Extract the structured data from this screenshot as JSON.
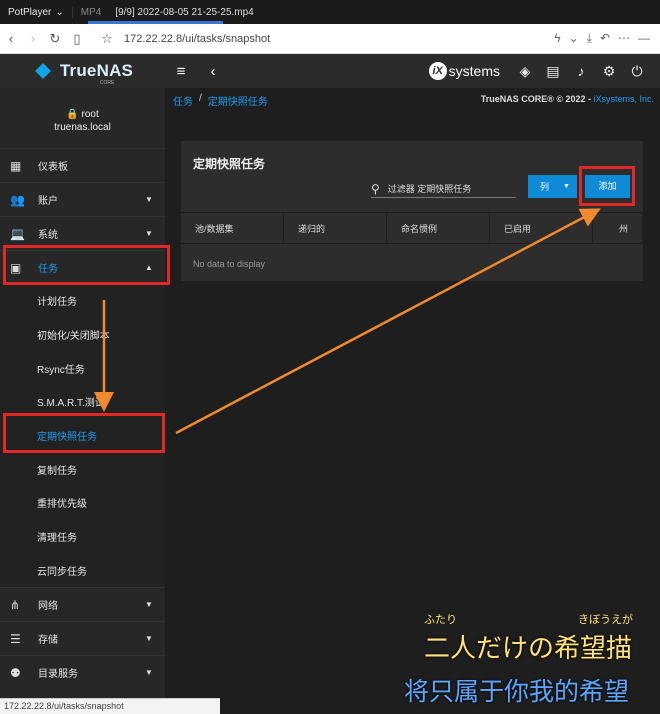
{
  "player": {
    "app_name": "PotPlayer",
    "format": "MP4",
    "file_title": "[9/9] 2022-08-05 21-25-25.mp4"
  },
  "browser": {
    "url": "172.22.22.8/ui/tasks/snapshot",
    "status_url": "172.22.22.8/ui/tasks/snapshot"
  },
  "topbar": {
    "brand": "TrueNAS",
    "brand_sub": "CORE",
    "vendor": "systems",
    "vendor_badge": "iX"
  },
  "sidebar": {
    "user_name": "root",
    "host_name": "truenas.local",
    "items": [
      {
        "label": "仪表板",
        "icon": "dashboard-icon"
      },
      {
        "label": "账户",
        "icon": "people-icon"
      },
      {
        "label": "系统",
        "icon": "laptop-icon"
      },
      {
        "label": "任务",
        "icon": "calendar-icon"
      }
    ],
    "sub_items": [
      {
        "label": "计划任务"
      },
      {
        "label": "初始化/关闭脚本"
      },
      {
        "label": "Rsync任务"
      },
      {
        "label": "S.M.A.R.T.测试"
      },
      {
        "label": "定期快照任务"
      },
      {
        "label": "复制任务"
      },
      {
        "label": "重排优先级"
      },
      {
        "label": "清理任务"
      },
      {
        "label": "云同步任务"
      }
    ],
    "lower_items": [
      {
        "label": "网络",
        "icon": "network-icon"
      },
      {
        "label": "存储",
        "icon": "storage-icon"
      },
      {
        "label": "目录服务",
        "icon": "directory-icon"
      }
    ]
  },
  "breadcrumb": {
    "root": "任务",
    "current": "定期快照任务"
  },
  "copyright": {
    "prefix": "TrueNAS CORE® © 2022 - ",
    "company": "iXsystems, Inc."
  },
  "card": {
    "title": "定期快照任务",
    "filter_placeholder": "过滤器 定期快照任务",
    "columns_button": "列",
    "add_button": "添加",
    "headers": [
      "池/数据集",
      "递归的",
      "命名惯例",
      "已启用",
      "州"
    ],
    "empty_text": "No data to display"
  },
  "subtitles": {
    "ruby_left": "ふたり",
    "ruby_right": "きぼうえが",
    "japanese": "二人だけの希望描",
    "chinese": "将只属于你我的希望"
  },
  "colors": {
    "accent": "#0f8ad6",
    "highlight": "#e02828",
    "arrow": "#f08a2c"
  }
}
